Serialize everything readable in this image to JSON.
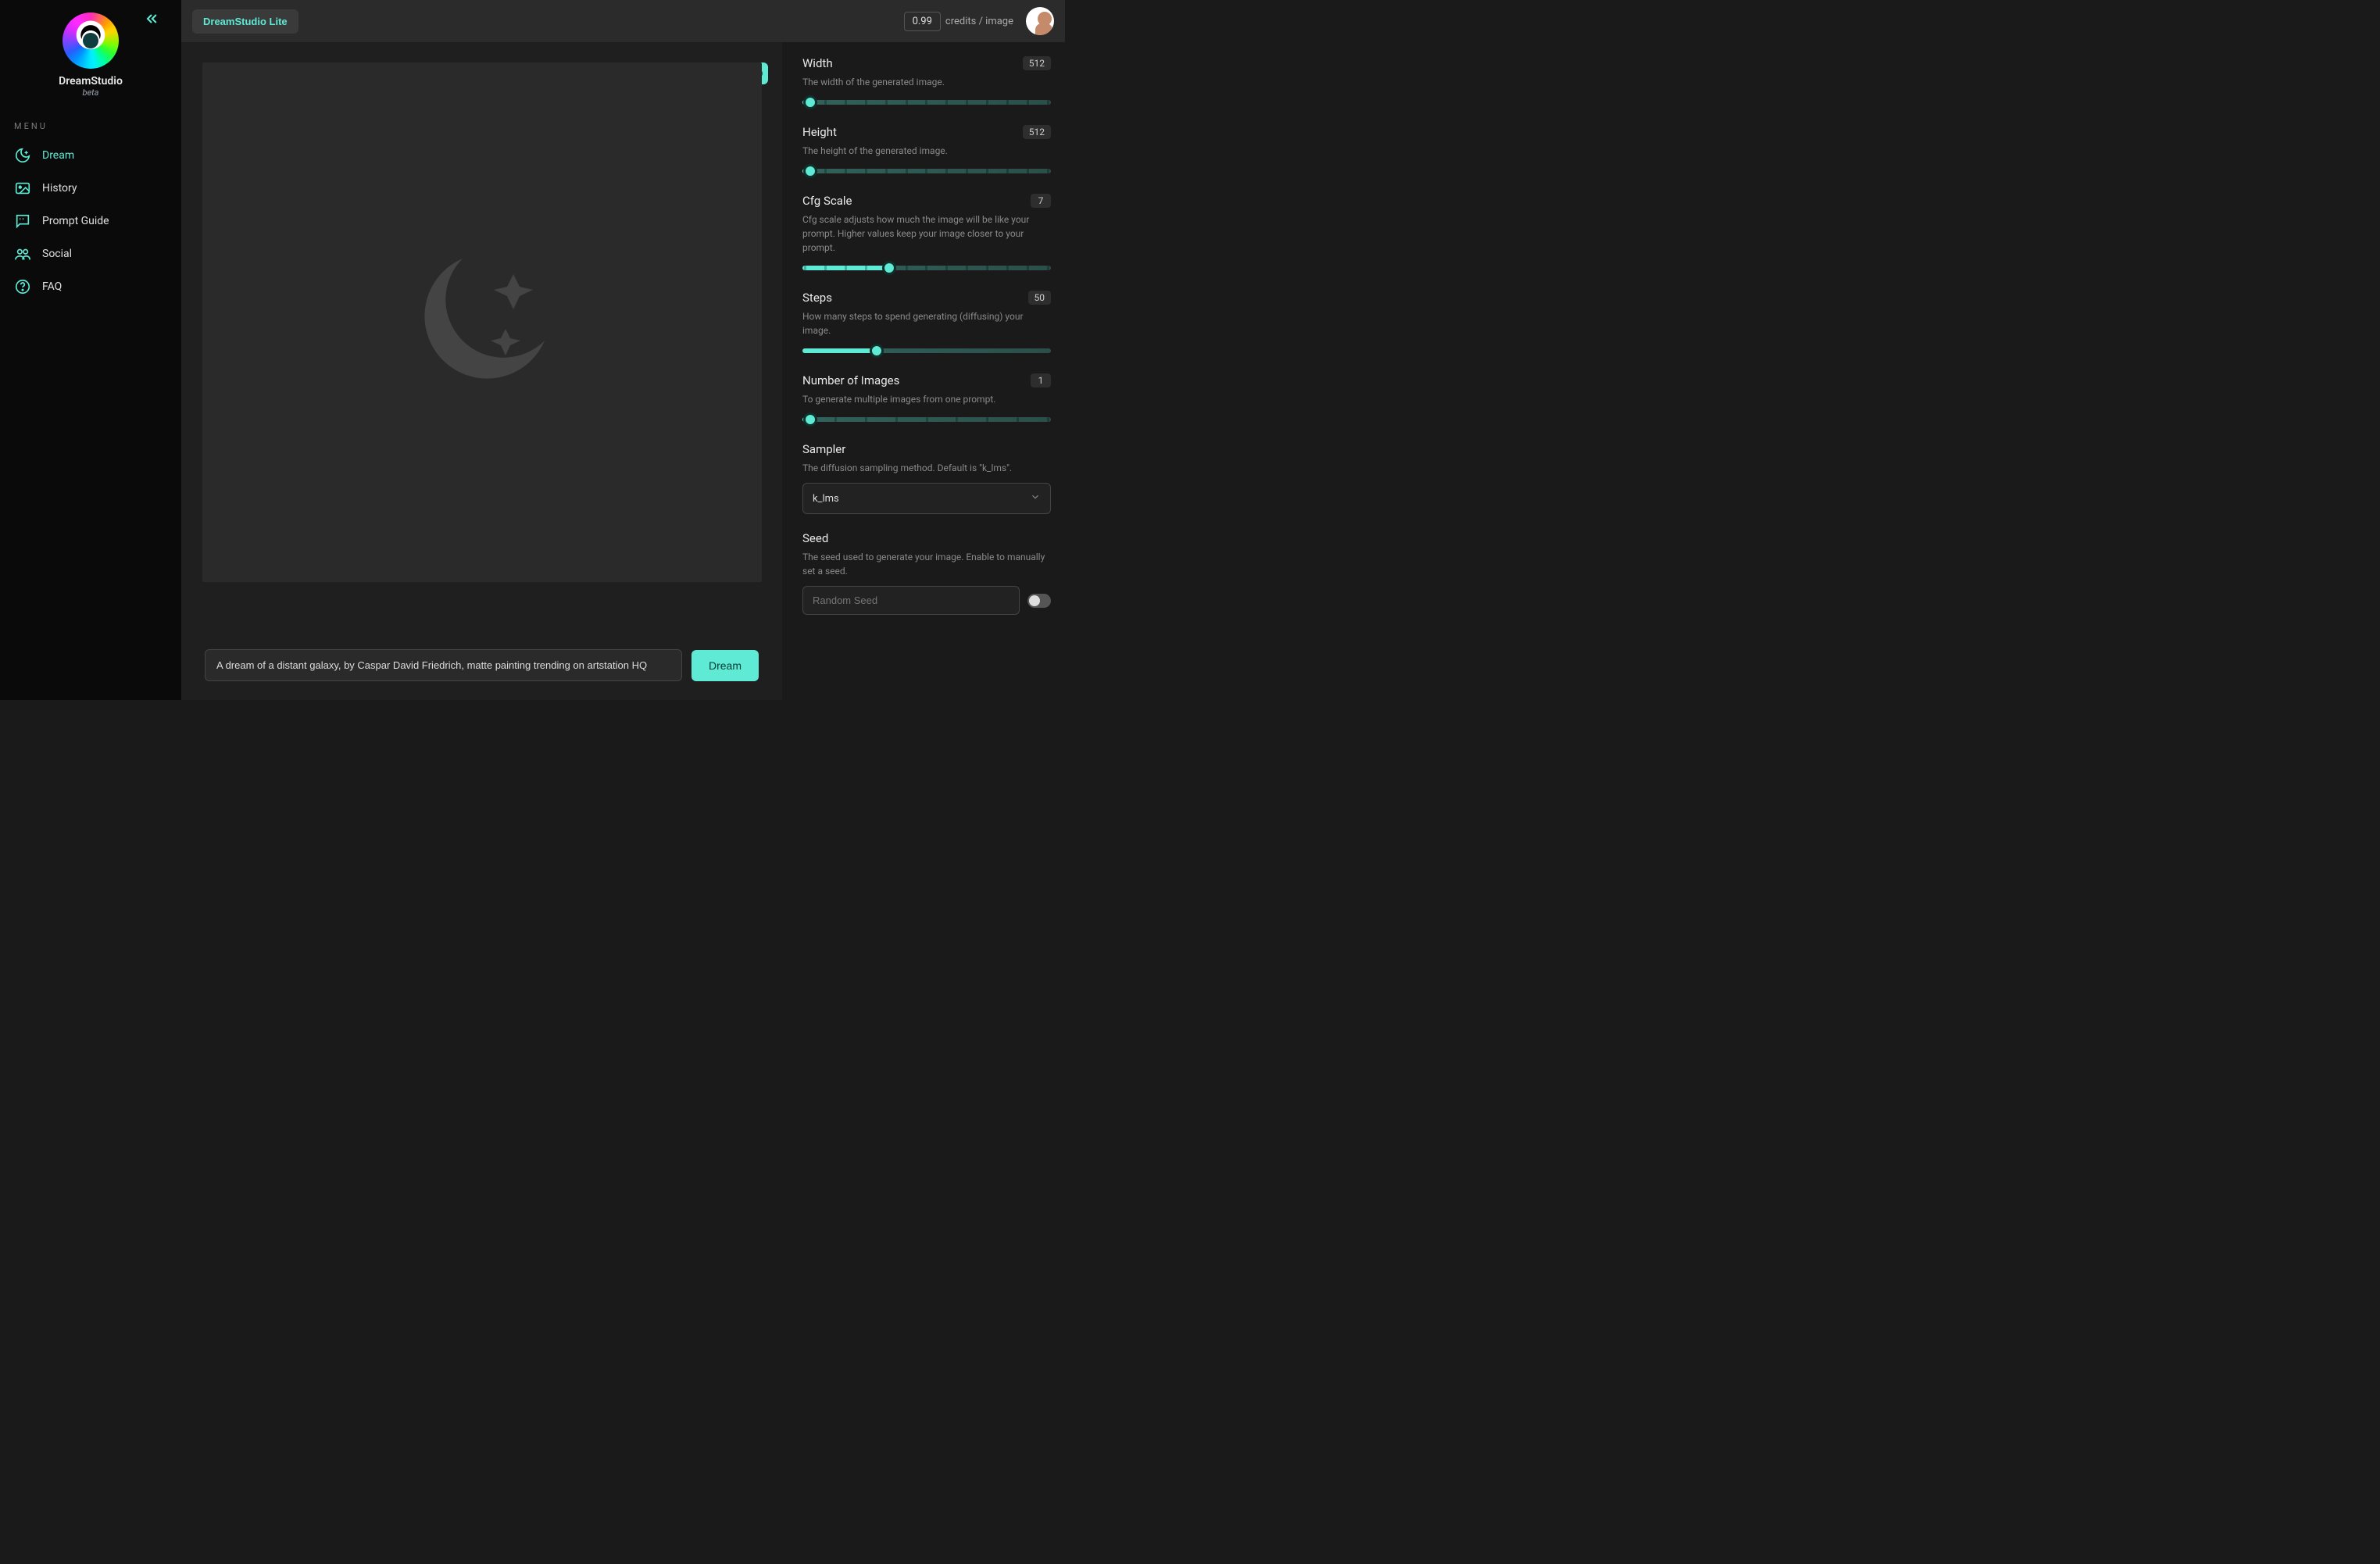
{
  "brand": {
    "title": "DreamStudio",
    "subtitle": "beta"
  },
  "sidebar": {
    "menu_header": "MENU",
    "items": [
      {
        "label": "Dream",
        "icon": "moon-icon"
      },
      {
        "label": "History",
        "icon": "image-icon"
      },
      {
        "label": "Prompt Guide",
        "icon": "chat-icon"
      },
      {
        "label": "Social",
        "icon": "users-icon"
      },
      {
        "label": "FAQ",
        "icon": "question-icon"
      }
    ]
  },
  "topbar": {
    "lite_label": "DreamStudio Lite",
    "credits_value": "0.99",
    "credits_label": "credits / image"
  },
  "prompt": {
    "value": "A dream of a distant galaxy, by Caspar David Friedrich, matte painting trending on artstation HQ",
    "dream_button": "Dream"
  },
  "settings": {
    "width": {
      "title": "Width",
      "value": "512",
      "desc": "The width of the generated image.",
      "thumb_pct": 3,
      "fill_pct": 3
    },
    "height": {
      "title": "Height",
      "value": "512",
      "desc": "The height of the generated image.",
      "thumb_pct": 3,
      "fill_pct": 3
    },
    "cfg": {
      "title": "Cfg Scale",
      "value": "7",
      "desc": "Cfg scale adjusts how much the image will be like your prompt. Higher values keep your image closer to your prompt.",
      "thumb_pct": 35,
      "fill_pct": 35
    },
    "steps": {
      "title": "Steps",
      "value": "50",
      "desc": "How many steps to spend generating (diffusing) your image.",
      "thumb_pct": 30,
      "fill_pct": 30
    },
    "num": {
      "title": "Number of Images",
      "value": "1",
      "desc": "To generate multiple images from one prompt.",
      "thumb_pct": 3,
      "fill_pct": 3
    },
    "sampler": {
      "title": "Sampler",
      "desc": "The diffusion sampling method. Default is \"k_lms\".",
      "selected": "k_lms"
    },
    "seed": {
      "title": "Seed",
      "desc": "The seed used to generate your image. Enable to manually set a seed.",
      "placeholder": "Random Seed"
    }
  }
}
